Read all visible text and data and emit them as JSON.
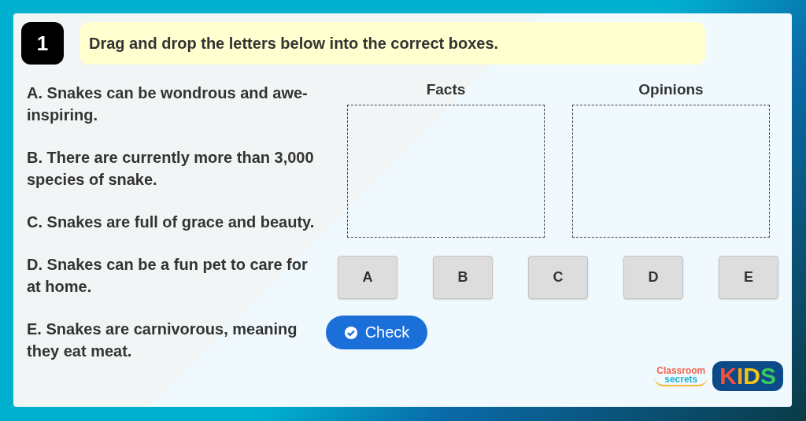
{
  "question": {
    "number": "1",
    "instruction": "Drag and drop the letters below into the correct boxes."
  },
  "statements": [
    "A. Snakes can be wondrous and awe-inspiring.",
    "B. There are currently more than 3,000 species of snake.",
    "C. Snakes are full of grace and beauty.",
    "D. Snakes can be a fun pet to care for at home.",
    "E. Snakes are carnivorous, meaning they eat meat."
  ],
  "drop_zones": [
    {
      "label": "Facts"
    },
    {
      "label": "Opinions"
    }
  ],
  "tiles": [
    "A",
    "B",
    "C",
    "D",
    "E"
  ],
  "check_button": {
    "label": "Check"
  },
  "logo": {
    "line_1": "Classroom",
    "line_2": "secrets",
    "badge": "KIDS"
  }
}
